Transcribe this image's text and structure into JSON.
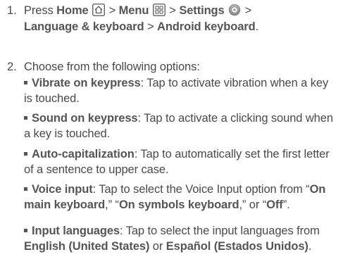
{
  "step1": {
    "number": "1.",
    "press": "Press",
    "home": "Home",
    "home_icon": "home-icon",
    "sep1": ">",
    "menu": "Menu",
    "menu_icon": "menu-grid-icon",
    "sep2": ">",
    "settings": "Settings",
    "settings_icon": "settings-icon",
    "sep3": ">",
    "language": "Language & keyboard",
    "sep4": ">",
    "android_keyboard": "Android keyboard",
    "end": "."
  },
  "step2": {
    "number": "2.",
    "text": "Choose from the following options:"
  },
  "options": {
    "vibrate_label": "Vibrate on keypress",
    "vibrate_text": ": Tap to activate vibration when a key is touched.",
    "sound_label": "Sound on keypress",
    "sound_text": ": Tap to activate a clicking sound when a key is touched.",
    "autocap_label": "Auto-capitalization",
    "autocap_text": ": Tap to automatically set the first letter of a sentence to upper case.",
    "voice_label": "Voice input",
    "voice_text1": ": Tap to select the Voice Input option from “",
    "voice_opt1": "On main keyboard",
    "voice_text2": ",” “",
    "voice_opt2": "On symbols keyboard",
    "voice_text3": ",” or “",
    "voice_opt3": "Off",
    "voice_text4": "”.",
    "input_label": "Input languages",
    "input_text1": ": Tap to select the input languages from ",
    "input_opt1": "English (United States)",
    "input_text2": " or ",
    "input_opt2": "Español (Estados Unidos)",
    "input_text3": "."
  }
}
